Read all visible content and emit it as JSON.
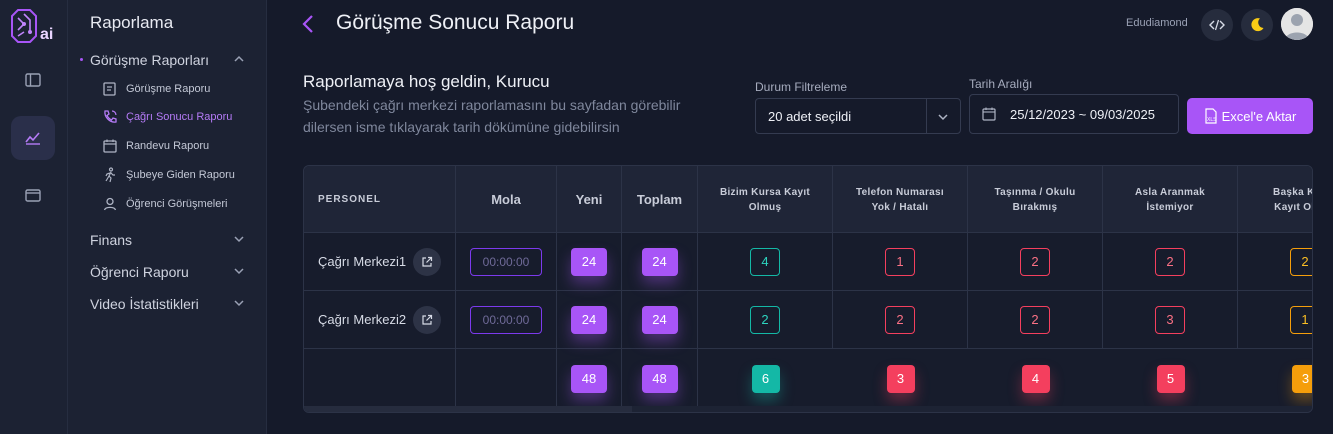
{
  "logo": {
    "icon": "brain-ai-logo",
    "text": "ai"
  },
  "rail": {
    "items": [
      {
        "icon": "layout-icon"
      },
      {
        "icon": "chart-icon",
        "active": true
      },
      {
        "icon": "wallet-icon"
      }
    ]
  },
  "sidebar": {
    "title": "Raporlama",
    "groups": [
      {
        "label": "Görüşme Raporları",
        "expanded": true,
        "items": [
          {
            "label": "Görüşme Raporu",
            "icon": "note-icon"
          },
          {
            "label": "Çağrı Sonucu Raporu",
            "icon": "phone-call-icon",
            "active": true
          },
          {
            "label": "Randevu Raporu",
            "icon": "calendar-icon"
          },
          {
            "label": "Şubeye Giden Raporu",
            "icon": "walking-icon"
          },
          {
            "label": "Öğrenci Görüşmeleri",
            "icon": "user-icon"
          }
        ]
      },
      {
        "label": "Finans"
      },
      {
        "label": "Öğrenci Raporu"
      },
      {
        "label": "Video İstatistikleri"
      }
    ]
  },
  "header": {
    "title": "Görüşme Sonucu Raporu",
    "brand": "Edudiamond"
  },
  "intro": {
    "welcome": "Raporlamaya hoş geldin, Kurucu",
    "description": "Şubendeki çağrı merkezi raporlamasını bu sayfadan görebilir dilersen isme tıklayarak tarih dökümüne gidebilirsin"
  },
  "filters": {
    "status_label": "Durum Filtreleme",
    "status_value": "20 adet seçildi",
    "date_label": "Tarih Aralığı",
    "date_value": "25/12/2023 ~ 09/03/2025",
    "export_label": "Excel'e Aktar"
  },
  "table": {
    "headers": [
      "PERSONEL",
      "Mola",
      "Yeni",
      "Toplam",
      "Bizim Kursa Kayıt Olmuş",
      "Telefon Numarası Yok / Hatalı",
      "Taşınma / Okulu Bırakmış",
      "Asla Aranmak İstemiyor",
      "Başka Kursa Kayıt Olmuş"
    ],
    "rows": [
      {
        "name": "Çağrı Merkezi1",
        "mola": "00:00:00",
        "values": [
          "24",
          "24",
          "4",
          "1",
          "2",
          "2",
          "2"
        ]
      },
      {
        "name": "Çağrı Merkezi2",
        "mola": "00:00:00",
        "values": [
          "24",
          "24",
          "2",
          "2",
          "2",
          "3",
          "1"
        ]
      }
    ],
    "totals": [
      "48",
      "48",
      "6",
      "3",
      "4",
      "5",
      "3"
    ]
  },
  "colors": {
    "accent": "#a855f7",
    "teal": "#14b8a6",
    "red": "#f43f5e",
    "orange": "#f59e0b"
  }
}
